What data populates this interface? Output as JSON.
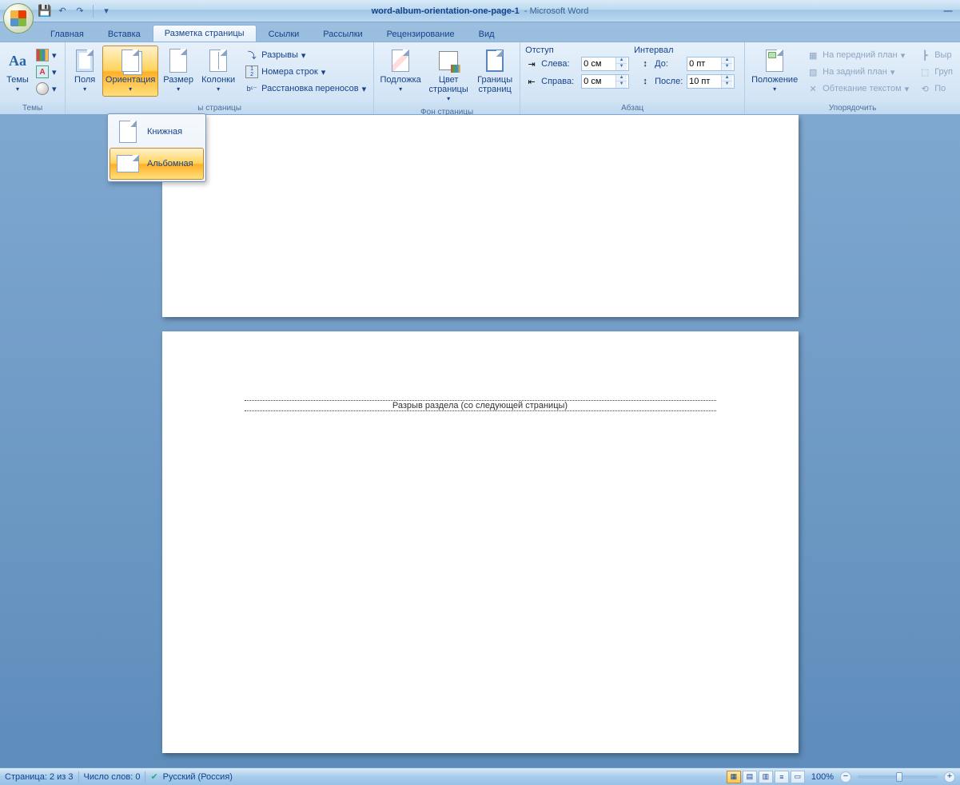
{
  "titlebar": {
    "doc_name": "word-album-orientation-one-page-1",
    "app_name": "Microsoft Word"
  },
  "tabs": {
    "home": "Главная",
    "insert": "Вставка",
    "layout": "Разметка страницы",
    "refs": "Ссылки",
    "mail": "Рассылки",
    "review": "Рецензирование",
    "view": "Вид"
  },
  "ribbon": {
    "themes_group": "Темы",
    "themes": "Темы",
    "page_setup_group": "ы страницы",
    "margins": "Поля",
    "orientation": "Ориентация",
    "size": "Размер",
    "columns": "Колонки",
    "breaks": "Разрывы",
    "line_numbers": "Номера строк",
    "hyphenation": "Расстановка переносов",
    "page_bg_group": "Фон страницы",
    "watermark": "Подложка",
    "page_color": "Цвет страницы",
    "page_borders": "Границы страниц",
    "paragraph_group": "Абзац",
    "indent_title": "Отступ",
    "indent_left_lbl": "Слева:",
    "indent_left_val": "0 см",
    "indent_right_lbl": "Справа:",
    "indent_right_val": "0 см",
    "spacing_title": "Интервал",
    "spacing_before_lbl": "До:",
    "spacing_before_val": "0 пт",
    "spacing_after_lbl": "После:",
    "spacing_after_val": "10 пт",
    "arrange_group": "Упорядочить",
    "position": "Положение",
    "bring_front": "На передний план",
    "send_back": "На задний план",
    "text_wrap": "Обтекание текстом",
    "align": "Выр",
    "group": "Груп",
    "rotate": "По"
  },
  "orientation_menu": {
    "portrait": "Книжная",
    "landscape": "Альбомная"
  },
  "document": {
    "section_break": "Разрыв раздела (со следующей страницы)"
  },
  "status": {
    "page": "Страница: 2 из 3",
    "words": "Число слов: 0",
    "lang": "Русский (Россия)",
    "zoom": "100%"
  }
}
